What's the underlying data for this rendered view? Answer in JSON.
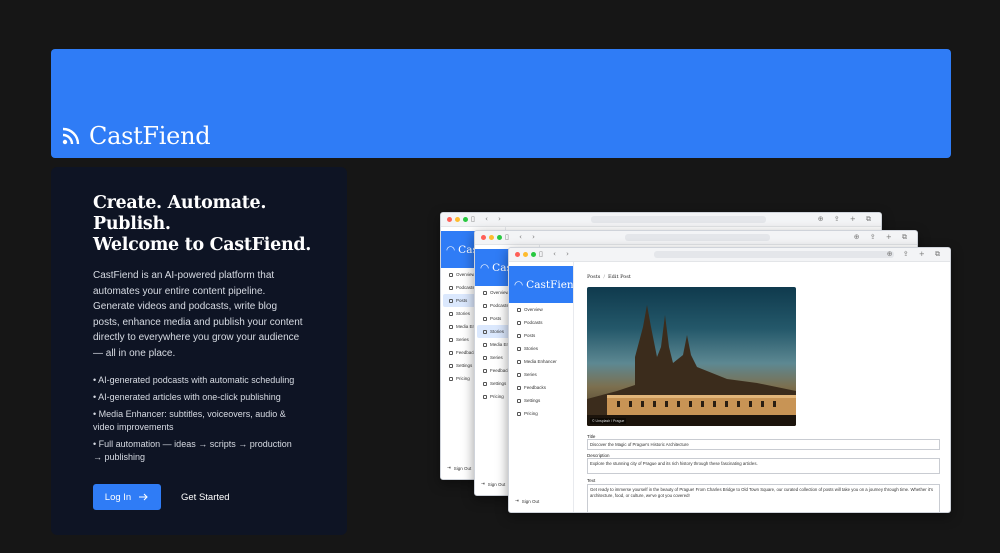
{
  "brand": {
    "name": "CastFiend",
    "accent": "#2f7cf6",
    "icon": "rss-icon"
  },
  "hero": {
    "title_lines": [
      "Create. Automate.",
      "Publish.",
      "Welcome to CastFiend."
    ],
    "description": "CastFiend is an AI-powered platform that automates your entire content pipeline. Generate videos and podcasts, write blog posts, enhance media and publish your content directly to everywhere you grow your audience — all in one place.",
    "features": [
      "• AI-generated podcasts with automatic scheduling",
      "• AI-generated articles with one-click publishing",
      "• Media Enhancer: subtitles, voiceovers, audio & video improvements",
      "• Full automation — ideas → scripts → production → publishing"
    ],
    "login_label": "Log In",
    "start_label": "Get Started"
  },
  "mockup": {
    "sidebar_logo": "CastFiend",
    "sidebar_logo_cut": "Cas",
    "sidebar_items": [
      "Overview",
      "Podcasts",
      "Posts",
      "Stories",
      "Media Enhancer",
      "Series",
      "Feedbacks",
      "Settings",
      "Pricing"
    ],
    "sign_out": "Sign Out",
    "breadcrumb": {
      "root": "Posts",
      "sep": "/",
      "current": "Edit Post"
    },
    "photo_caption": "© Unsplash / Prague",
    "title_label": "Title",
    "title_value": "Discover the Magic of Prague's Historic Architecture",
    "description_label": "Description",
    "description_value": "Explore the stunning city of Prague and its rich history through these fascinating articles.",
    "text_label": "Text",
    "text_value": "Get ready to immerse yourself in the beauty of Prague! From Charles Bridge to Old Town Square, our curated collection of posts will take you on a journey through time. Whether it's architecture, food, or culture, we've got you covered!"
  }
}
